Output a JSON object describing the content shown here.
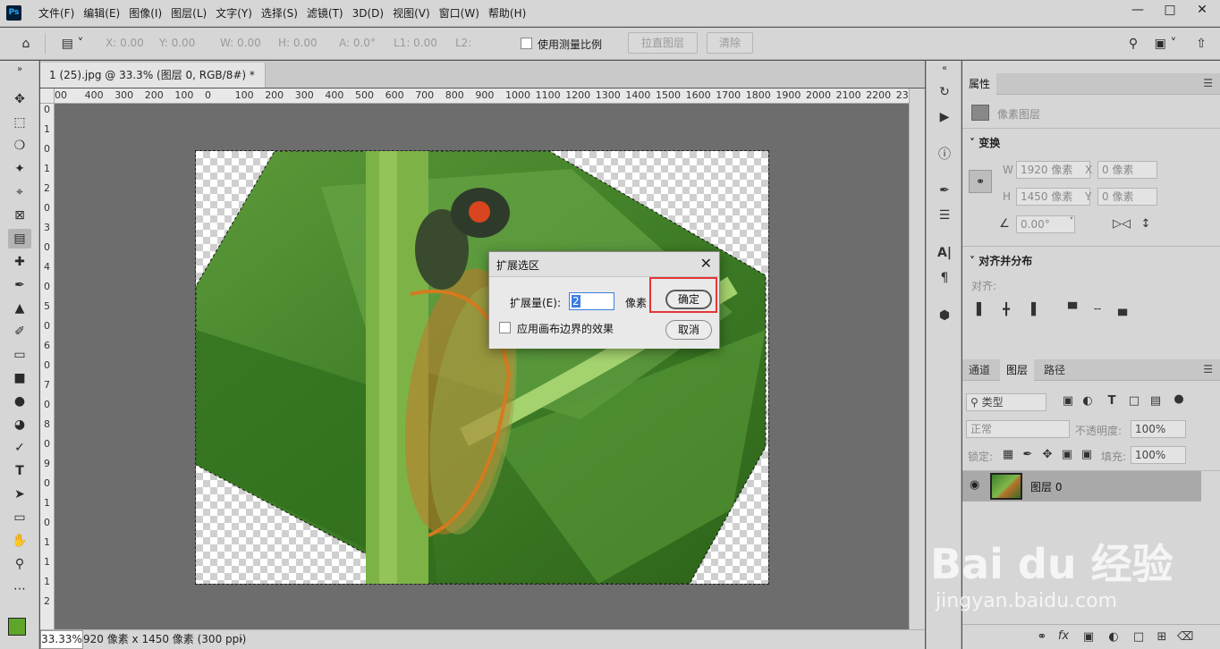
{
  "app": {
    "logo": "Ps",
    "menu": [
      "文件(F)",
      "编辑(E)",
      "图像(I)",
      "图层(L)",
      "文字(Y)",
      "选择(S)",
      "滤镜(T)",
      "3D(D)",
      "视图(V)",
      "窗口(W)",
      "帮助(H)"
    ]
  },
  "options_bar": {
    "x": "X: 0.00",
    "y": "Y: 0.00",
    "w": "W: 0.00",
    "h": "H: 0.00",
    "a": "A: 0.0°",
    "l1": "L1: 0.00",
    "l2": "L2:",
    "measure_scale_label": "使用测量比例",
    "straighten_button": "拉直图层",
    "clear_button": "清除"
  },
  "document": {
    "tab_title": "1 (25).jpg @ 33.3% (图层 0, RGB/8#) *",
    "ruler_h": [
      "00",
      "400",
      "300",
      "200",
      "100",
      "0",
      "100",
      "200",
      "300",
      "400",
      "500",
      "600",
      "700",
      "800",
      "900",
      "1000",
      "1100",
      "1200",
      "1300",
      "1400",
      "1500",
      "1600",
      "1700",
      "1800",
      "1900",
      "2000",
      "2100",
      "2200",
      "2300"
    ],
    "ruler_v": [
      "0",
      "1",
      "0",
      "1",
      "2",
      "0",
      "3",
      "0",
      "4",
      "0",
      "5",
      "0",
      "6",
      "0",
      "7",
      "0",
      "8",
      "0",
      "9",
      "0",
      "1",
      "0",
      "1",
      "1",
      "1",
      "2"
    ],
    "zoom": "33.33%",
    "info": "920 像素 x 1450 像素 (300 ppi)"
  },
  "dialog": {
    "title": "扩展选区",
    "expand_label": "扩展量(E):",
    "expand_value": "2",
    "unit": "像素",
    "canvas_bounds_label": "应用画布边界的效果",
    "ok_button": "确定",
    "cancel_button": "取消",
    "highlight_color": "#e53535"
  },
  "properties": {
    "tab": "属性",
    "type_label": "像素图层",
    "transform_title": "变换",
    "w_label": "W",
    "w_value": "1920 像素",
    "h_label": "H",
    "h_value": "1450 像素",
    "x_label": "X",
    "x_value": "0 像素",
    "y_label": "Y",
    "y_value": "0 像素",
    "angle_value": "0.00°",
    "align_title": "对齐并分布",
    "align_label": "对齐:"
  },
  "layers": {
    "tabs": [
      "通道",
      "图层",
      "路径"
    ],
    "filter_label": "类型",
    "blend_mode": "正常",
    "opacity_label": "不透明度:",
    "opacity_value": "100%",
    "lock_label": "锁定:",
    "fill_label": "填充:",
    "fill_value": "100%",
    "layer_name": "图层 0"
  },
  "watermark": {
    "logo": "Bai du 经验",
    "url": "jingyan.baidu.com"
  }
}
